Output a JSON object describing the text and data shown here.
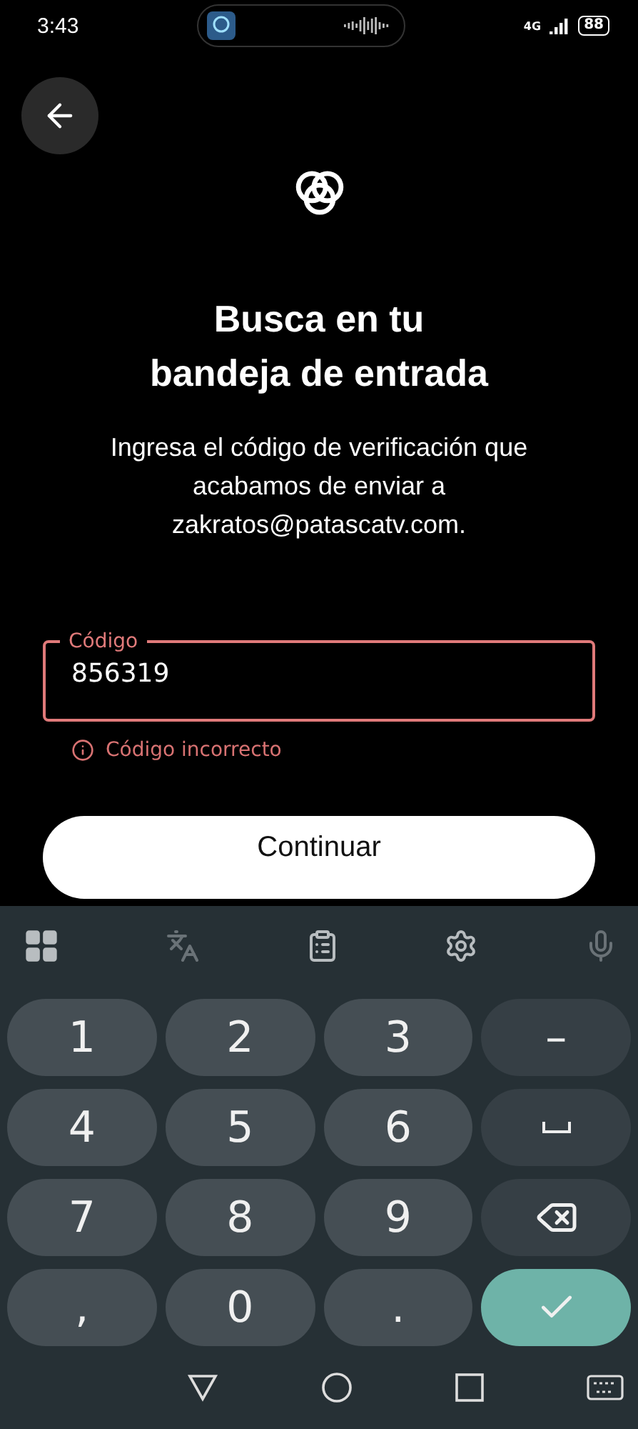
{
  "status_bar": {
    "time": "3:43",
    "network": "4G",
    "battery": "88"
  },
  "title": "Busca en tu\nbandeja de entrada",
  "message": "Ingresa el código de verificación que acabamos de enviar a zakratos@patascatv.com.",
  "code_field": {
    "label": "Código",
    "value": "856319",
    "error": true,
    "error_text": "Código incorrecto"
  },
  "continue_button": "Continuar",
  "keyboard": {
    "rows": [
      [
        {
          "kind": "char",
          "label": "1"
        },
        {
          "kind": "char",
          "label": "2"
        },
        {
          "kind": "char",
          "label": "3"
        },
        {
          "kind": "char",
          "label": "–"
        }
      ],
      [
        {
          "kind": "char",
          "label": "4"
        },
        {
          "kind": "char",
          "label": "5"
        },
        {
          "kind": "char",
          "label": "6"
        },
        {
          "kind": "space"
        }
      ],
      [
        {
          "kind": "char",
          "label": "7"
        },
        {
          "kind": "char",
          "label": "8"
        },
        {
          "kind": "char",
          "label": "9"
        },
        {
          "kind": "backspace"
        }
      ],
      [
        {
          "kind": "char",
          "label": ","
        },
        {
          "kind": "char",
          "label": "0"
        },
        {
          "kind": "char",
          "label": "."
        },
        {
          "kind": "enter"
        }
      ]
    ]
  }
}
